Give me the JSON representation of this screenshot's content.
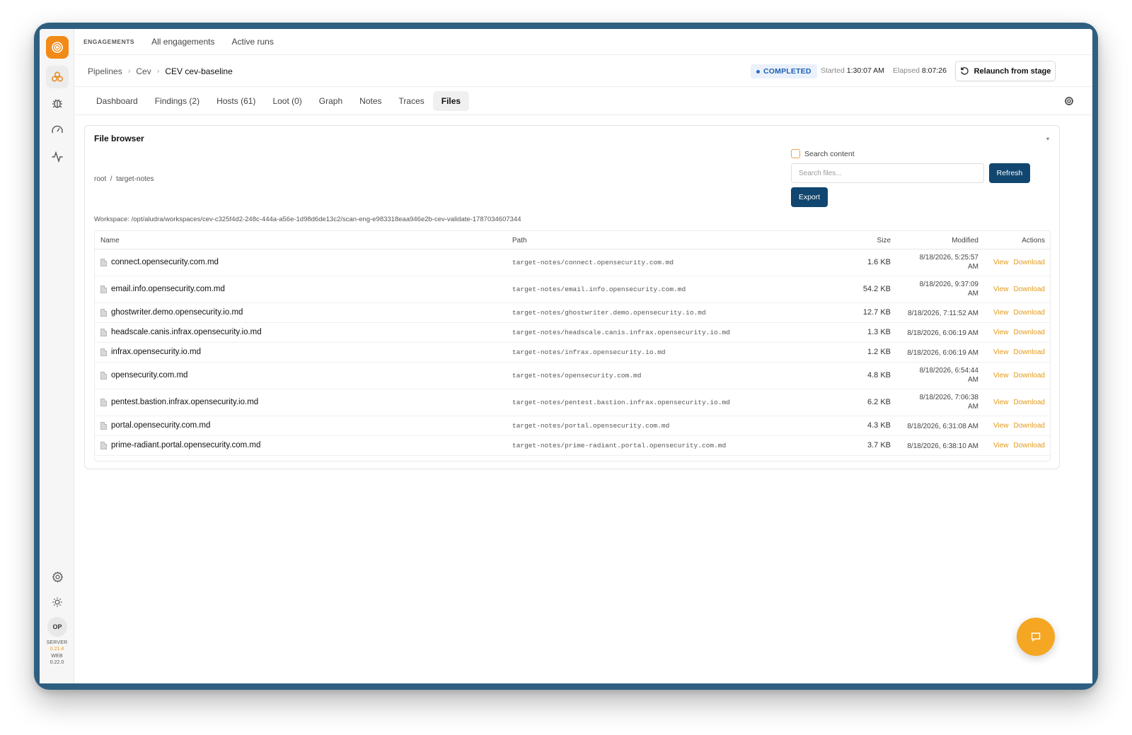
{
  "nav": {
    "section_label": "ENGAGEMENTS",
    "links": [
      "All engagements",
      "Active runs"
    ]
  },
  "sidebar": {
    "items": [
      {
        "icon": "logo-target-icon"
      },
      {
        "icon": "engagements-hex-icon",
        "active": true
      },
      {
        "icon": "bug-icon"
      },
      {
        "icon": "gauge-icon"
      },
      {
        "icon": "activity-icon"
      }
    ],
    "bottom": {
      "avatar": "OP",
      "server_label": "SERVER",
      "server_version": "0.21.4",
      "web_label": "WEB",
      "web_version": "0.22.0"
    }
  },
  "breadcrumb": [
    "Pipelines",
    "Cev",
    "CEV cev-baseline"
  ],
  "run": {
    "status": "COMPLETED",
    "started_label": "Started",
    "started_value": "1:30:07 AM",
    "elapsed_label": "Elapsed",
    "elapsed_value": "8:07:26",
    "relaunch_label": "Relaunch from stage"
  },
  "tabs": [
    {
      "label": "Dashboard"
    },
    {
      "label": "Findings (2)"
    },
    {
      "label": "Hosts (61)"
    },
    {
      "label": "Loot (0)"
    },
    {
      "label": "Graph"
    },
    {
      "label": "Notes"
    },
    {
      "label": "Traces"
    },
    {
      "label": "Files",
      "active": true
    }
  ],
  "file_browser": {
    "title": "File browser",
    "path": "root  /  target-notes",
    "search_content_label": "Search content",
    "search_placeholder": "Search files...",
    "refresh_label": "Refresh",
    "export_label": "Export",
    "workspace": "Workspace: /opt/aludra/workspaces/cev-c325f4d2-248c-444a-a56e-1d98d6de13c2/scan-eng-e983318eaa946e2b-cev-validate-1787034607344",
    "columns": {
      "name": "Name",
      "path": "Path",
      "size": "Size",
      "modified": "Modified",
      "actions": "Actions"
    },
    "action_view": "View",
    "action_download": "Download",
    "files": [
      {
        "name": "connect.opensecurity.com.md",
        "path": "target-notes/connect.opensecurity.com.md",
        "size": "1.6 KB",
        "modified_line1": "8/18/2026, 5:25:57",
        "modified_line2": "AM"
      },
      {
        "name": "email.info.opensecurity.com.md",
        "path": "target-notes/email.info.opensecurity.com.md",
        "size": "54.2 KB",
        "modified_line1": "8/18/2026, 9:37:09",
        "modified_line2": "AM"
      },
      {
        "name": "ghostwriter.demo.opensecurity.io.md",
        "path": "target-notes/ghostwriter.demo.opensecurity.io.md",
        "size": "12.7 KB",
        "modified_line1": "8/18/2026, 7:11:52 AM",
        "modified_line2": ""
      },
      {
        "name": "headscale.canis.infrax.opensecurity.io.md",
        "path": "target-notes/headscale.canis.infrax.opensecurity.io.md",
        "size": "1.3 KB",
        "modified_line1": "8/18/2026, 6:06:19 AM",
        "modified_line2": ""
      },
      {
        "name": "infrax.opensecurity.io.md",
        "path": "target-notes/infrax.opensecurity.io.md",
        "size": "1.2 KB",
        "modified_line1": "8/18/2026, 6:06:19 AM",
        "modified_line2": ""
      },
      {
        "name": "opensecurity.com.md",
        "path": "target-notes/opensecurity.com.md",
        "size": "4.8 KB",
        "modified_line1": "8/18/2026, 6:54:44",
        "modified_line2": "AM"
      },
      {
        "name": "pentest.bastion.infrax.opensecurity.io.md",
        "path": "target-notes/pentest.bastion.infrax.opensecurity.io.md",
        "size": "6.2 KB",
        "modified_line1": "8/18/2026, 7:06:38",
        "modified_line2": "AM"
      },
      {
        "name": "portal.opensecurity.com.md",
        "path": "target-notes/portal.opensecurity.com.md",
        "size": "4.3 KB",
        "modified_line1": "8/18/2026, 6:31:08 AM",
        "modified_line2": ""
      },
      {
        "name": "prime-radiant.portal.opensecurity.com.md",
        "path": "target-notes/prime-radiant.portal.opensecurity.com.md",
        "size": "3.7 KB",
        "modified_line1": "8/18/2026, 6:38:10 AM",
        "modified_line2": ""
      }
    ]
  },
  "colors": {
    "accent": "#f28a17",
    "primary": "#10466f",
    "status_blue": "#1d5fb0",
    "frame": "#2f5f80"
  },
  "fab": {
    "icon": "chat-icon"
  }
}
